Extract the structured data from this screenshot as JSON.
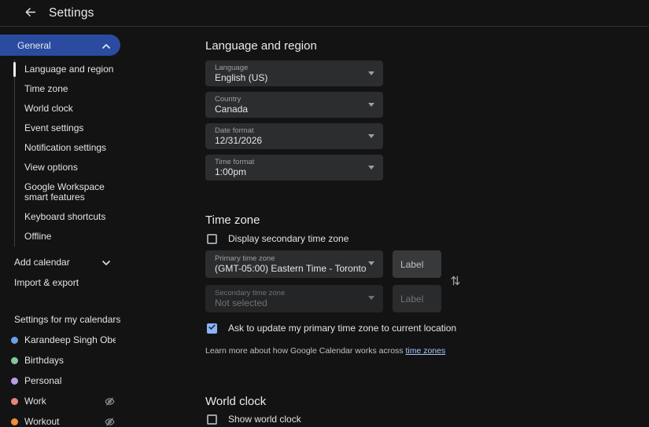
{
  "header": {
    "title": "Settings"
  },
  "sidebar": {
    "general_label": "General",
    "general_items": [
      {
        "label": "Language and region"
      },
      {
        "label": "Time zone"
      },
      {
        "label": "World clock"
      },
      {
        "label": "Event settings"
      },
      {
        "label": "Notification settings"
      },
      {
        "label": "View options"
      },
      {
        "label": "Google Workspace smart features"
      },
      {
        "label": "Keyboard shortcuts"
      },
      {
        "label": "Offline"
      }
    ],
    "add_calendar_label": "Add calendar",
    "import_export_label": "Import & export",
    "my_calendars_header": "Settings for my calendars",
    "my_calendars": [
      {
        "label": "Karandeep Singh Oberoi",
        "color": "#6c9eeb",
        "hidden": false
      },
      {
        "label": "Birthdays",
        "color": "#84c796",
        "hidden": false
      },
      {
        "label": "Personal",
        "color": "#b79de0",
        "hidden": false
      },
      {
        "label": "Work",
        "color": "#e8837e",
        "hidden": true
      },
      {
        "label": "Workout",
        "color": "#ef9038",
        "hidden": true
      }
    ]
  },
  "main": {
    "language_region": {
      "title": "Language and region",
      "fields": [
        {
          "label": "Language",
          "value": "English (US)"
        },
        {
          "label": "Country",
          "value": "Canada"
        },
        {
          "label": "Date format",
          "value": "12/31/2026"
        },
        {
          "label": "Time format",
          "value": "1:00pm"
        }
      ]
    },
    "time_zone": {
      "title": "Time zone",
      "display_secondary": {
        "label": "Display secondary time zone",
        "checked": false
      },
      "primary": {
        "label": "Primary time zone",
        "value": "(GMT-05:00) Eastern Time - Toronto",
        "label_placeholder": "Label"
      },
      "secondary": {
        "label": "Secondary time zone",
        "value": "Not selected",
        "label_placeholder": "Label"
      },
      "ask_update": {
        "label": "Ask to update my primary time zone to current location",
        "checked": true
      },
      "learn_more_prefix": "Learn more about how Google Calendar works across ",
      "learn_more_link": "time zones"
    },
    "world_clock": {
      "title": "World clock",
      "show_world_clock": {
        "label": "Show world clock",
        "checked": false
      }
    }
  },
  "colors": {
    "background": "#131314",
    "accent_blue": "#2a4ba0",
    "link": "#a8c7fa",
    "checkbox_checked": "#8ab4f8",
    "field_bg": "#2c2d2f",
    "field_bg_disabled": "#242527",
    "label_box_bg": "#38393b"
  }
}
